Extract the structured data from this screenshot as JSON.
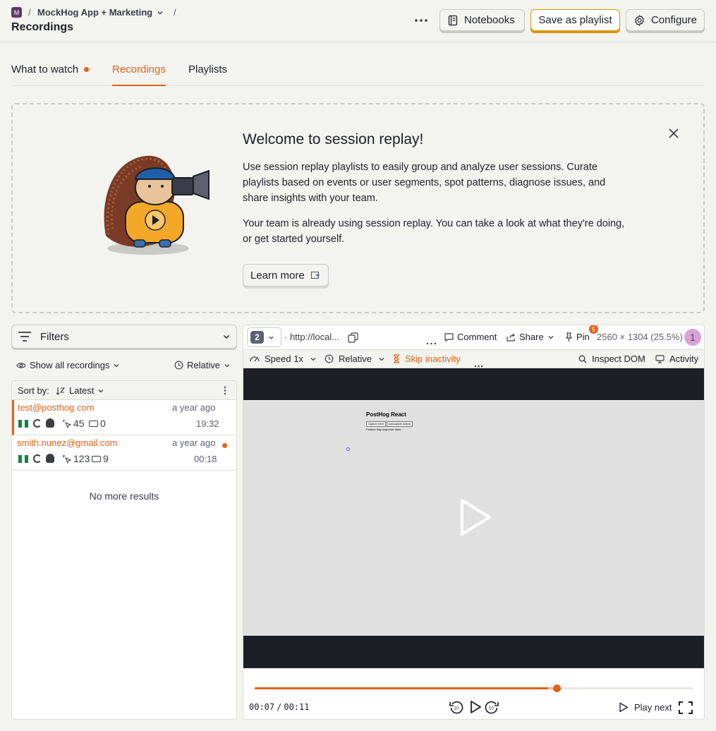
{
  "header": {
    "org_initial": "M",
    "project": "MockHog App + Marketing",
    "sep": "/",
    "title": "Recordings",
    "more_label": "⋯",
    "notebooks": "Notebooks",
    "save_playlist": "Save as playlist",
    "configure": "Configure"
  },
  "tabs": [
    {
      "label": "What to watch"
    },
    {
      "label": "Recordings"
    },
    {
      "label": "Playlists"
    }
  ],
  "welcome": {
    "title": "Welcome to session replay!",
    "p1": "Use session replay playlists to easily group and analyze user sessions. Curate playlists based on events or user segments, spot patterns, diagnose issues, and share insights with your team.",
    "p2": "Your team is already using session replay. You can take a look at what they're doing, or get started yourself.",
    "learn_more": "Learn more"
  },
  "sidebar": {
    "filters_label": "Filters",
    "show_all": "Show all recordings",
    "relative": "Relative",
    "sort_by": "Sort by:",
    "latest": "Latest",
    "no_more": "No more results",
    "recordings": [
      {
        "email": "test@posthog.com",
        "ago": "a year ago",
        "clicks": "45",
        "keys": "0",
        "duration": "19:32"
      },
      {
        "email": "smith.nunez@gmail.com",
        "ago": "a year ago",
        "clicks": "123",
        "keys": "9",
        "duration": "00:18"
      }
    ]
  },
  "player": {
    "tab_count": "2",
    "url": "· http://local...",
    "comment": "Comment",
    "share": "Share",
    "pin": "Pin",
    "pin_badge": "5",
    "resolution": "2560 × 1304 (25.5%)",
    "user_badge": "1",
    "speed": "Speed 1x",
    "relative": "Relative",
    "skip_inactivity": "Skip inactivity",
    "inspect_dom": "Inspect DOM",
    "activity": "Activity",
    "page_title": "PostHog React",
    "page_btn1": "Capture event",
    "page_btn2": "Autocapture buttons",
    "page_flag": "Feature flag response: false",
    "time_current": "00:07",
    "time_sep": "/",
    "time_total": "00:11",
    "play_next": "Play next",
    "progress": 0.67,
    "buffered": 0.69
  },
  "colors": {
    "accent": "#e2621b",
    "brand_yellow": "#dc9300",
    "background": "#f3f4ef"
  }
}
